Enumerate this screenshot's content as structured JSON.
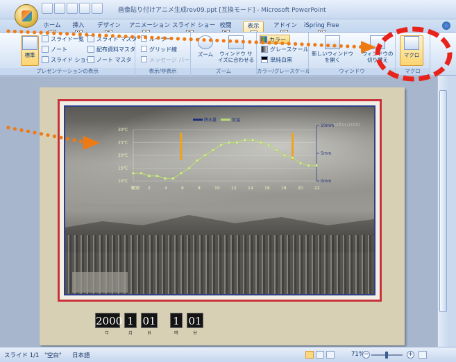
{
  "window": {
    "title": "画像貼り付けアニメ生成rev09.ppt [互換モード] - Microsoft PowerPoint"
  },
  "ribbon_tabs": [
    {
      "label": "ホーム",
      "key": "H"
    },
    {
      "label": "挿入",
      "key": "N"
    },
    {
      "label": "デザイン",
      "key": "G"
    },
    {
      "label": "アニメーション",
      "key": "A"
    },
    {
      "label": "スライド ショー",
      "key": "S"
    },
    {
      "label": "校閲",
      "key": "R"
    },
    {
      "label": "表示",
      "key": "W"
    },
    {
      "label": "アドイン",
      "key": "X"
    },
    {
      "label": "iSpring Free",
      "key": "Y"
    }
  ],
  "ribbon": {
    "presentation_view": {
      "label": "プレゼンテーションの表示",
      "normal": "標準",
      "slide_sorter": "スライド一覧",
      "notes": "ノート",
      "slide_show": "スライド ショー",
      "slide_master": "スライド マスタ",
      "handout_master": "配布資料マスタ",
      "notes_master": "ノート マスタ"
    },
    "show_hide": {
      "label": "表示/非表示",
      "ruler": "ルーラー",
      "gridlines": "グリッド線",
      "message_bar": "メッセージ バー"
    },
    "zoom": {
      "label": "ズーム",
      "zoom": "ズーム",
      "fit_window": "ウィンドウ サイズに合わせる"
    },
    "color": {
      "label": "カラー/グレースケール",
      "color": "カラー",
      "grayscale": "グレースケール",
      "black_white": "単純白黒"
    },
    "window": {
      "label": "ウィンドウ",
      "new_window": "新しいウィンドウを開く",
      "switch_windows": "ウィンドウの切り替え"
    },
    "macro": {
      "label": "マクロ",
      "macro": "マクロ"
    }
  },
  "slide": {
    "watermark": "tofton2000",
    "chart_data": {
      "type": "line",
      "legend": [
        "降水量",
        "気温"
      ],
      "x_ticks": [
        "観測",
        "2",
        "4",
        "6",
        "8",
        "10",
        "12",
        "14",
        "16",
        "18",
        "20",
        "22"
      ],
      "left_ticks": [
        "30℃",
        "25℃",
        "20℃",
        "15℃",
        "10℃"
      ],
      "right_ticks": [
        "10mm",
        "5mm",
        "0mm"
      ],
      "series": [
        {
          "name": "気温",
          "values": [
            13,
            13,
            12,
            12,
            11,
            11,
            13,
            15,
            18,
            20,
            22,
            24,
            25,
            25,
            26,
            26,
            25,
            24,
            22,
            20,
            19,
            17,
            16,
            16
          ]
        },
        {
          "name": "降水量",
          "values": [
            0,
            0,
            0,
            0,
            0,
            0,
            4,
            0,
            0,
            0,
            0,
            0,
            0,
            0,
            0,
            0,
            0,
            0,
            0,
            0,
            4,
            0,
            0,
            0
          ]
        }
      ]
    },
    "counter": {
      "year": "2000",
      "month": "1",
      "day": "01",
      "hour": "1",
      "minute": "01",
      "year_unit": "年",
      "month_unit": "月",
      "day_unit": "日",
      "hour_unit": "時",
      "minute_unit": "分"
    }
  },
  "status": {
    "slide": "スライド 1/1",
    "theme": "\"空白\"",
    "language": "日本語",
    "zoom": "71%"
  },
  "annotation_color": "#e8231b",
  "dot_color": "#f07a12"
}
